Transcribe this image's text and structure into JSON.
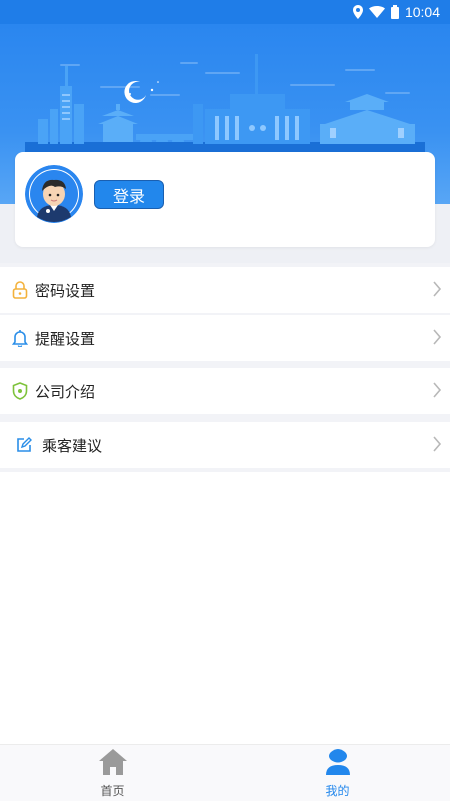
{
  "status_bar": {
    "time": "10:04",
    "icons": [
      "location-icon",
      "wifi-icon",
      "battery-icon"
    ]
  },
  "profile": {
    "login_label": "登录",
    "avatar_icon": "user-avatar"
  },
  "menu": {
    "items": [
      {
        "label": "密码设置",
        "icon": "lock-icon",
        "icon_color": "#f3b23c"
      },
      {
        "label": "提醒设置",
        "icon": "bell-icon",
        "icon_color": "#2a8ee8"
      },
      {
        "label": "公司介绍",
        "icon": "shield-icon",
        "icon_color": "#7dc23a"
      },
      {
        "label": "乘客建议",
        "icon": "edit-icon",
        "icon_color": "#2a8ee8"
      }
    ]
  },
  "bottom_nav": {
    "tabs": [
      {
        "label": "首页",
        "icon": "home-icon",
        "active": false
      },
      {
        "label": "我的",
        "icon": "profile-icon",
        "active": true
      }
    ]
  },
  "colors": {
    "primary": "#2287ec",
    "hero": "#2a86ef",
    "active_tab": "#2287ec",
    "inactive_tab": "#9a9a9a"
  }
}
